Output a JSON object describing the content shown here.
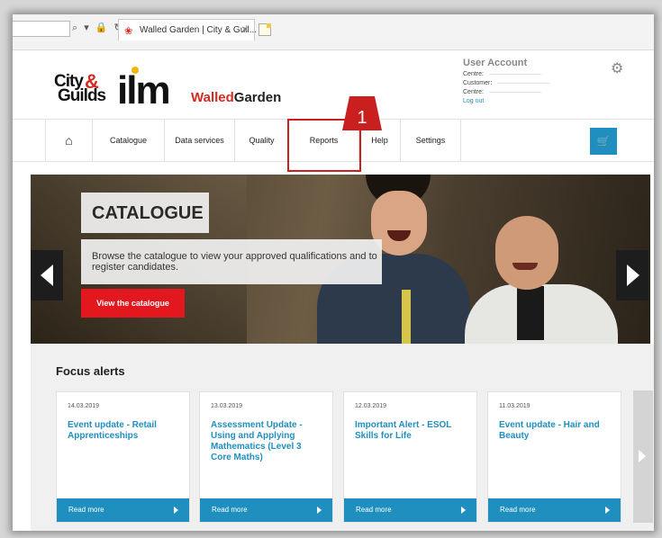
{
  "browser": {
    "controls": "⌕ ▾ 🔒 ↻",
    "tab_title": "Walled Garden | City & Guil...",
    "tab_close": "✕"
  },
  "branding": {
    "cg_city": "City",
    "cg_guilds": "Guilds",
    "cg_amp": "&",
    "ilm": "ilm",
    "wg_part1": "Walled",
    "wg_part2": "Garden"
  },
  "user_account": {
    "title": "User Account",
    "centre1": "Centre:",
    "customer": "Customer:",
    "centre2": "Centre:",
    "logout": "Log out"
  },
  "nav": {
    "home_icon": "⌂",
    "catalogue": "Catalogue",
    "data_services": "Data services",
    "quality": "Quality",
    "reports": "Reports",
    "help": "Help",
    "settings": "Settings",
    "cart_icon": "🛒"
  },
  "annotation": {
    "badge_number": "1",
    "badge_color": "#c91f1f"
  },
  "hero": {
    "title": "CATALOGUE",
    "description": "Browse the catalogue to view your approved qualifications and to register candidates.",
    "button": "View the catalogue"
  },
  "focus": {
    "title": "Focus alerts",
    "cards": [
      {
        "date": "14.03.2019",
        "headline": "Event update - Retail Apprenticeships",
        "more": "Read more"
      },
      {
        "date": "13.03.2019",
        "headline": "Assessment Update - Using and Applying Mathematics (Level 3 Core Maths)",
        "more": "Read more"
      },
      {
        "date": "12.03.2019",
        "headline": "Important Alert - ESOL Skills for Life",
        "more": "Read more"
      },
      {
        "date": "11.03.2019",
        "headline": "Event update - Hair and Beauty",
        "more": "Read more"
      }
    ]
  },
  "colors": {
    "brand_red": "#e3171e",
    "accent_blue": "#1f8fbf"
  }
}
